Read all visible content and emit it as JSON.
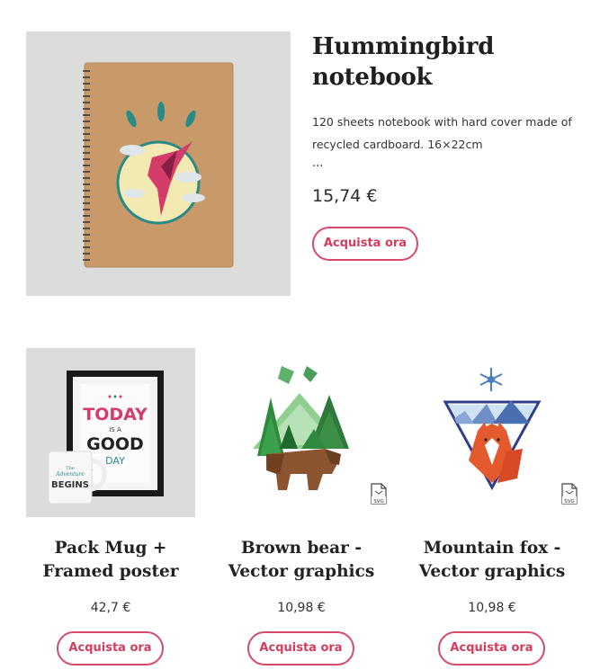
{
  "featured": {
    "title": "Hummingbird notebook",
    "description": "120 sheets notebook with hard cover made of recycled cardboard. 16×22cm",
    "ellipsis": "...",
    "price": "15,74 €",
    "button": "Acquista ora"
  },
  "products": [
    {
      "title": "Pack Mug + Framed poster",
      "price": "42,7 €",
      "button": "Acquista ora",
      "poster_lines": [
        "TODAY",
        "IS A",
        "GOOD",
        "DAY"
      ],
      "mug_lines": [
        "The",
        "Adventure",
        "BEGINS"
      ]
    },
    {
      "title": "Brown bear - Vector graphics",
      "price": "10,98 €",
      "button": "Acquista ora",
      "badge": "SVG"
    },
    {
      "title": "Mountain fox - Vector graphics",
      "price": "10,98 €",
      "button": "Acquista ora",
      "badge": "SVG"
    }
  ],
  "colors": {
    "accent": "#d94a6a",
    "image_bg": "#dcdcdc"
  }
}
